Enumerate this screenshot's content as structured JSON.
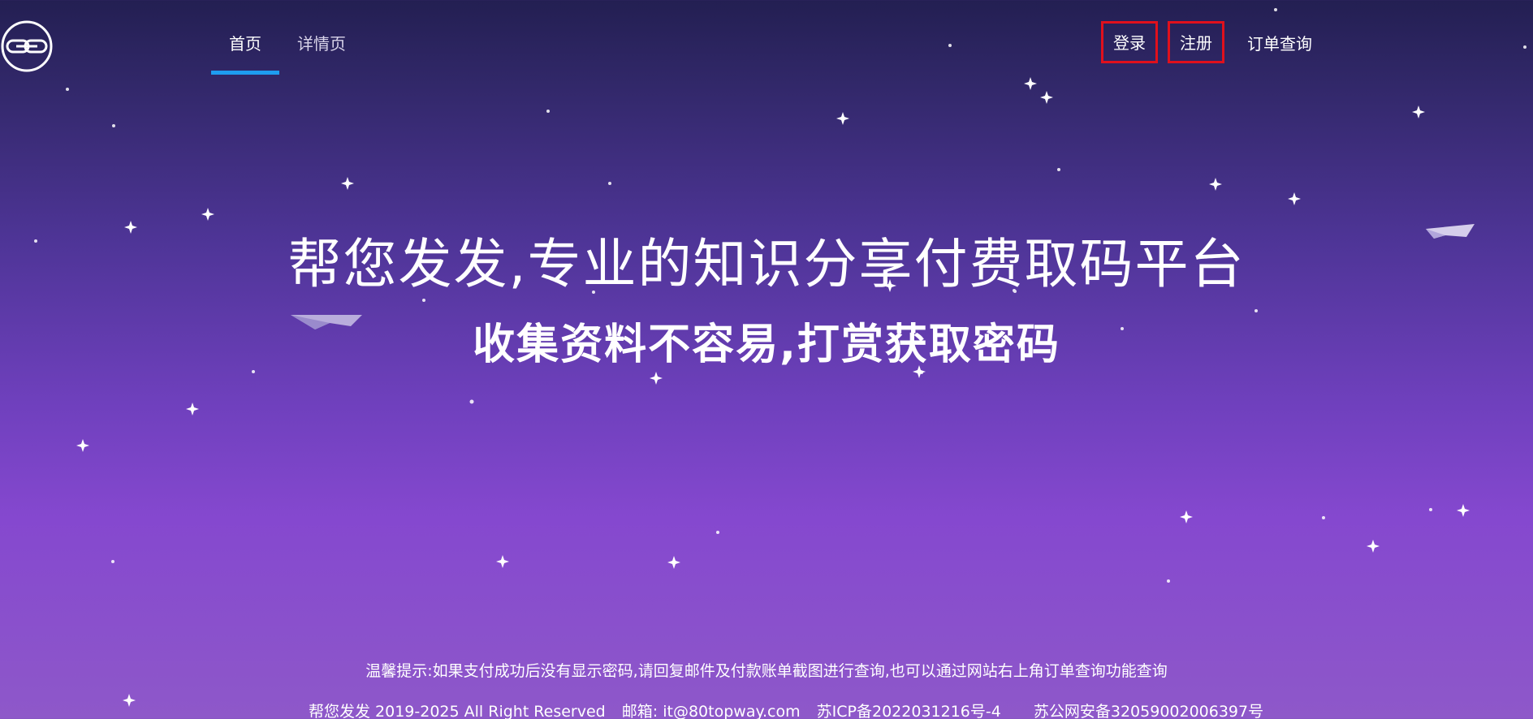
{
  "brand": {
    "logo_icon": "link-icon"
  },
  "nav": {
    "tabs": [
      {
        "label": "首页",
        "active": true
      },
      {
        "label": "详情页",
        "active": false
      }
    ]
  },
  "header": {
    "login_label": "登录",
    "register_label": "注册",
    "order_query_label": "订单查询",
    "highlight_color": "#e0101c"
  },
  "hero": {
    "title": "帮您发发,专业的知识分享付费取码平台",
    "subtitle": "收集资料不容易,打赏获取密码"
  },
  "footer": {
    "tip": "温馨提示:如果支付成功后没有显示密码,请回复邮件及付款账单截图进行查询,也可以通过网站右上角订单查询功能查询",
    "copyright": "帮您发发 2019-2025 All Right Reserved",
    "email": "邮箱: it@80topway.com",
    "icp": "苏ICP备2022031216号-4",
    "police_beian": "苏公网安备32059002006397号"
  },
  "theme": {
    "accent_tab_underline": "#1e9cf0",
    "background_top": "#231f52",
    "background_bottom": "#8e58c9"
  }
}
